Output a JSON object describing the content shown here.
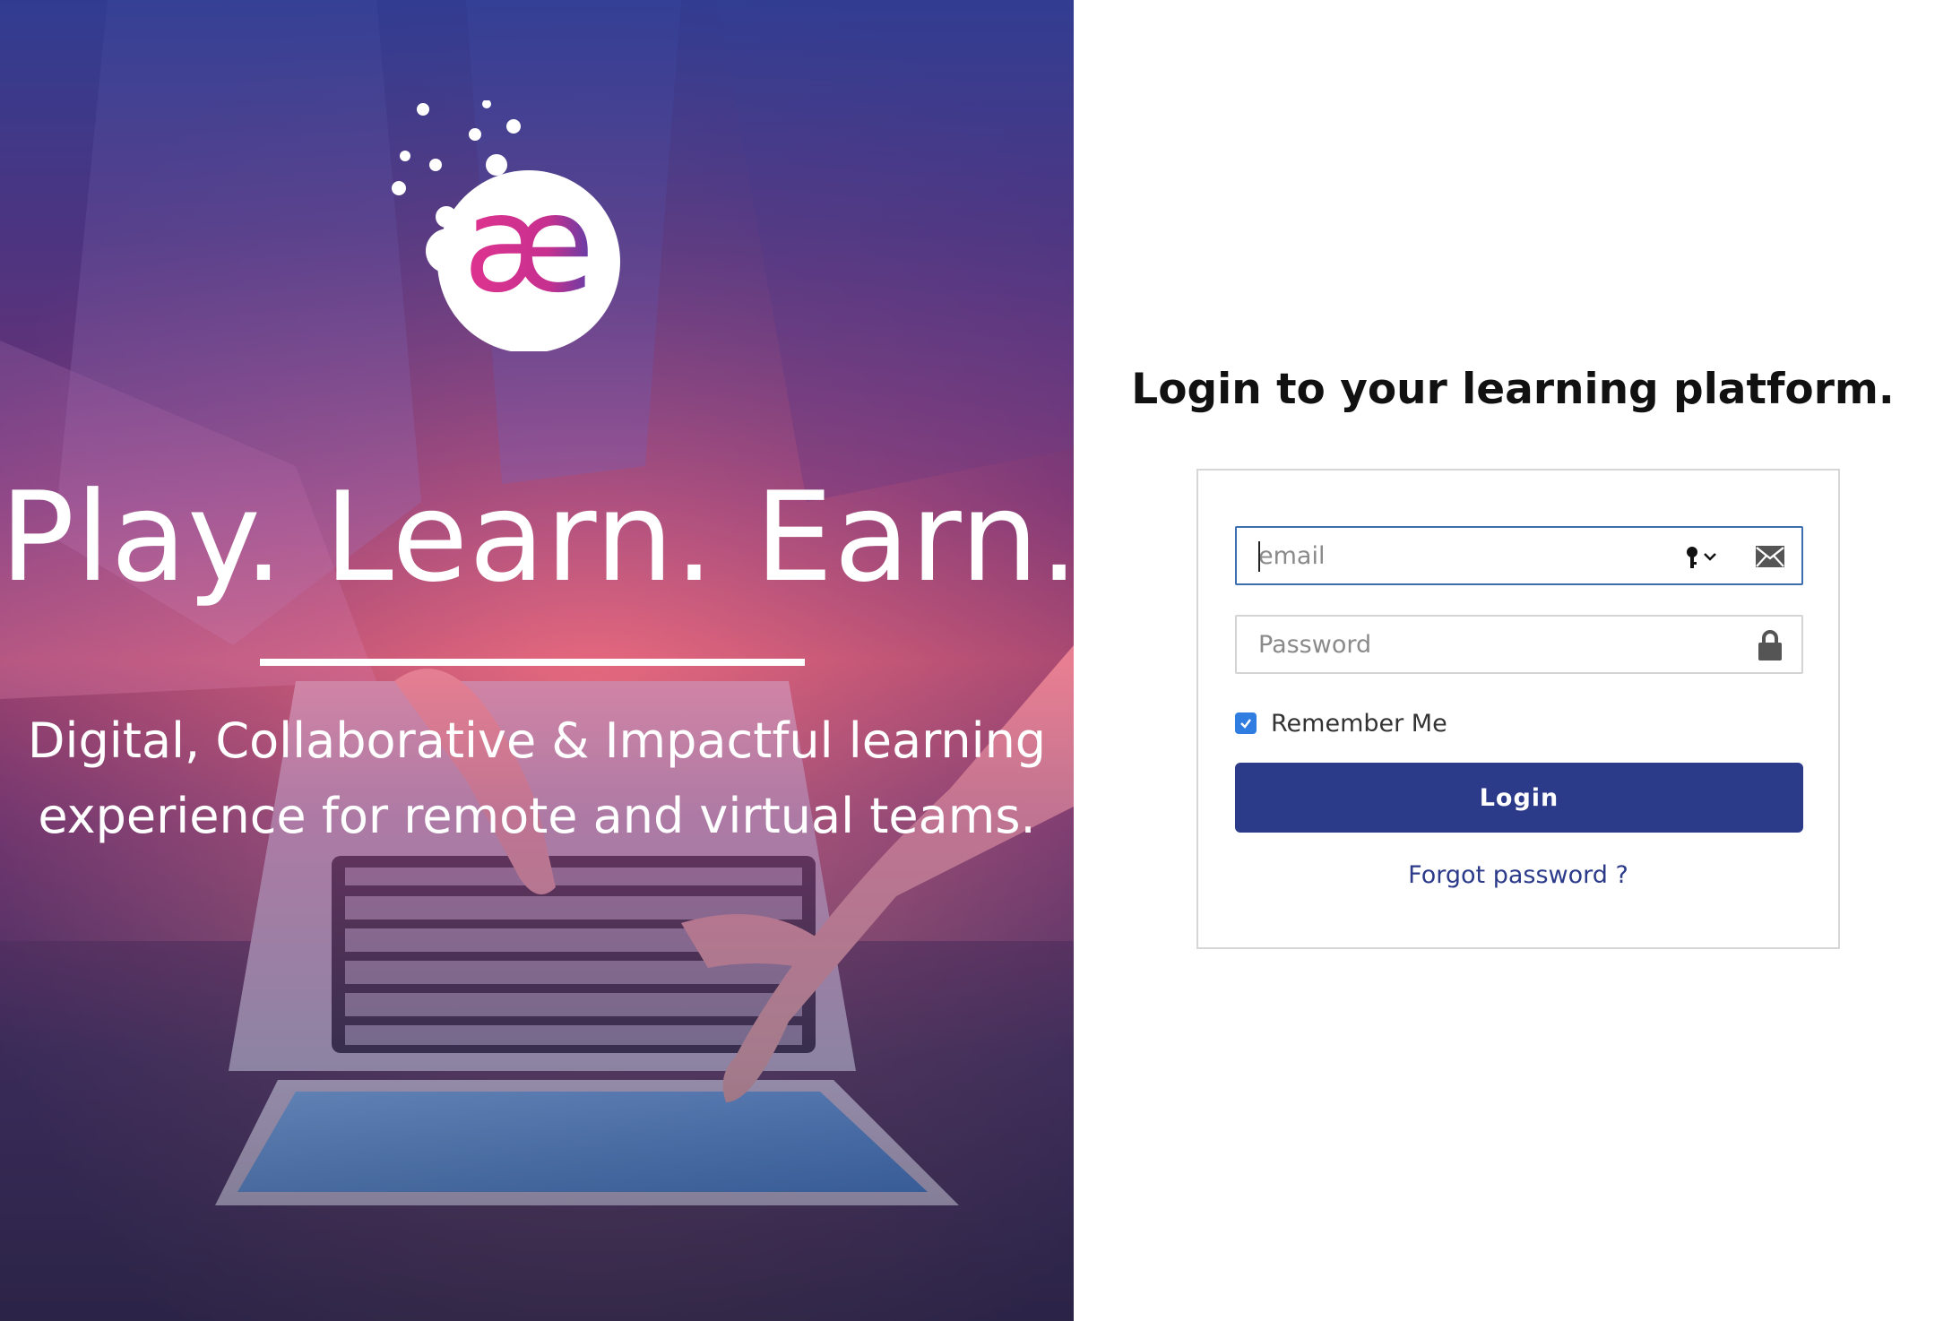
{
  "hero": {
    "logo_text": "æ",
    "headline": "Play. Learn. Earn.",
    "subtitle_line1": "Digital, Collaborative & Impactful learning",
    "subtitle_line2": "experience for remote and virtual teams."
  },
  "login": {
    "title": "Login to your learning platform.",
    "email_placeholder": "email",
    "password_placeholder": "Password",
    "remember_label": "Remember Me",
    "remember_checked": true,
    "login_button": "Login",
    "forgot_link": "Forgot password ?"
  },
  "colors": {
    "primary": "#2c3a8a",
    "checkbox": "#2f7de1",
    "logo_pink": "#e0338f",
    "logo_purple": "#5b3fa8",
    "hero_top": "#303e96",
    "hero_mid": "#e15082"
  },
  "icons": {
    "email_field": "mail-icon",
    "password_field": "lock-icon",
    "password_manager": "key-icon"
  }
}
